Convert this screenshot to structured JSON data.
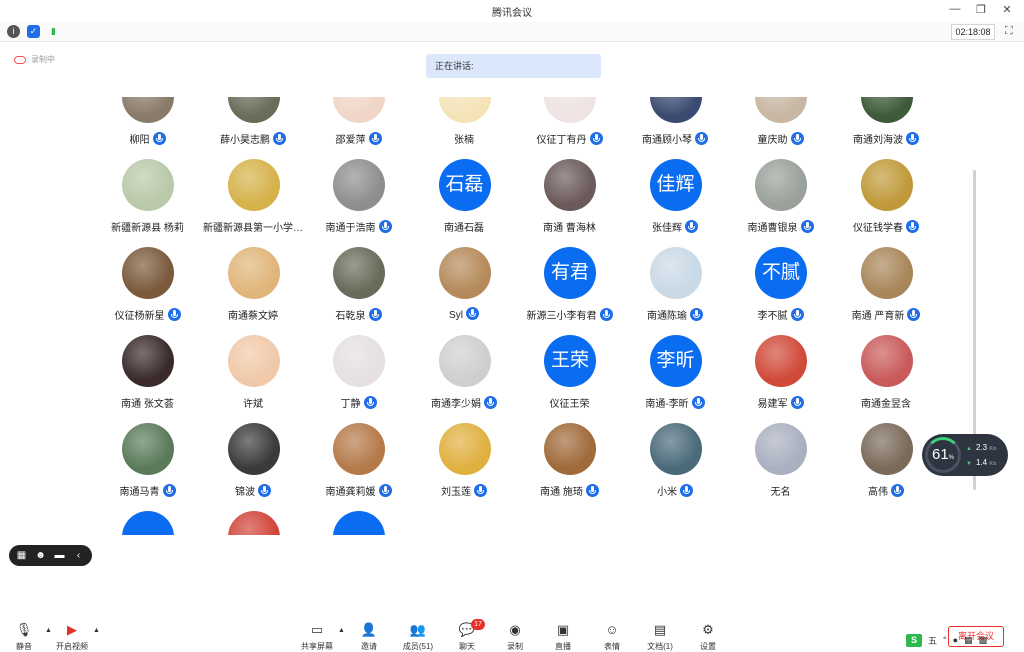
{
  "window": {
    "title": "腾讯会议",
    "controls": [
      "—",
      "❐",
      "✕"
    ]
  },
  "status": {
    "clock": "02:18:08",
    "icons": [
      "info-icon",
      "shield-icon",
      "signal-icon"
    ]
  },
  "recording": {
    "label": "录制中"
  },
  "speaking": {
    "label": "正在讲话:"
  },
  "participants": [
    {
      "name": "柳阳",
      "mic": true,
      "avatar": "photo",
      "color": "#8a7a6a"
    },
    {
      "name": "薛小昊志鹏",
      "mic": true,
      "avatar": "photo",
      "color": "#6b6b5a"
    },
    {
      "name": "邵爱萍",
      "mic": true,
      "avatar": "photo",
      "color": "#f1d6c8"
    },
    {
      "name": "张楠",
      "mic": false,
      "avatar": "photo",
      "color": "#f5e3b8"
    },
    {
      "name": "仪征丁有丹",
      "mic": true,
      "avatar": "photo",
      "color": "#efe3e3"
    },
    {
      "name": "南通顾小琴",
      "mic": true,
      "avatar": "photo",
      "color": "#3b4a70"
    },
    {
      "name": "童庆助",
      "mic": true,
      "avatar": "photo",
      "color": "#c7b7a3"
    },
    {
      "name": "南通刘海波",
      "mic": true,
      "avatar": "photo",
      "color": "#3e5a3a"
    },
    {
      "name": "新疆新源县 杨莉",
      "mic": false,
      "avatar": "photo",
      "color": "#b9c9a9"
    },
    {
      "name": "新疆新源县第一小学…",
      "mic": false,
      "avatar": "photo",
      "color": "#d5b24a"
    },
    {
      "name": "南通于浩南",
      "mic": true,
      "avatar": "photo",
      "color": "#8e8e8e"
    },
    {
      "name": "南通石磊",
      "mic": false,
      "avatar": "text",
      "text": "石磊"
    },
    {
      "name": "南通 曹海林",
      "mic": false,
      "avatar": "photo",
      "color": "#6b5a5a"
    },
    {
      "name": "张佳辉",
      "mic": true,
      "avatar": "text",
      "text": "佳辉"
    },
    {
      "name": "南通曹银泉",
      "mic": true,
      "avatar": "photo",
      "color": "#9aa09a"
    },
    {
      "name": "仪征钱学春",
      "mic": true,
      "avatar": "photo",
      "color": "#c09a3a"
    },
    {
      "name": "仪征杨新星",
      "mic": true,
      "avatar": "photo",
      "color": "#7a5a3a"
    },
    {
      "name": "南通蔡文婷",
      "mic": false,
      "avatar": "photo",
      "color": "#e0b57a"
    },
    {
      "name": "石乾泉",
      "mic": true,
      "avatar": "photo",
      "color": "#6a6a5a"
    },
    {
      "name": "Syl",
      "mic": true,
      "avatar": "photo",
      "color": "#b58a5a"
    },
    {
      "name": "新源三小李有君",
      "mic": true,
      "avatar": "text",
      "text": "有君"
    },
    {
      "name": "南通陈瑜",
      "mic": true,
      "avatar": "photo",
      "color": "#c9d9e6"
    },
    {
      "name": "李不腻",
      "mic": true,
      "avatar": "text",
      "text": "不腻"
    },
    {
      "name": "南通 严育新",
      "mic": true,
      "avatar": "photo",
      "color": "#a9865a"
    },
    {
      "name": "南通 张文荟",
      "mic": false,
      "avatar": "photo",
      "color": "#3a2a2a"
    },
    {
      "name": "许斌",
      "mic": false,
      "avatar": "photo",
      "color": "#f0c9a9"
    },
    {
      "name": "丁静",
      "mic": true,
      "avatar": "photo",
      "color": "#e6e0e0"
    },
    {
      "name": "南通李少娟",
      "mic": true,
      "avatar": "photo",
      "color": "#cfcfcf"
    },
    {
      "name": "仪征王荣",
      "mic": false,
      "avatar": "text",
      "text": "王荣"
    },
    {
      "name": "南通-李昕",
      "mic": true,
      "avatar": "text",
      "text": "李昕"
    },
    {
      "name": "易建军",
      "mic": true,
      "avatar": "photo",
      "color": "#d04a3a"
    },
    {
      "name": "南通金昱含",
      "mic": false,
      "avatar": "photo",
      "color": "#c95a5a"
    },
    {
      "name": "南通马青",
      "mic": true,
      "avatar": "photo",
      "color": "#5a7a5a"
    },
    {
      "name": "锦波",
      "mic": true,
      "avatar": "photo",
      "color": "#3a3a3a"
    },
    {
      "name": "南通龚莉媛",
      "mic": true,
      "avatar": "photo",
      "color": "#b57a4a"
    },
    {
      "name": "刘玉莲",
      "mic": true,
      "avatar": "photo",
      "color": "#e0b040"
    },
    {
      "name": "南通 施琦",
      "mic": true,
      "avatar": "photo",
      "color": "#a06a3a"
    },
    {
      "name": "小米",
      "mic": true,
      "avatar": "photo",
      "color": "#4a6a7a"
    },
    {
      "name": "无名",
      "mic": false,
      "avatar": "photo",
      "color": "#aab0c0"
    },
    {
      "name": "高伟",
      "mic": true,
      "avatar": "photo",
      "color": "#7a6a5a"
    },
    {
      "name": "",
      "mic": false,
      "avatar": "text",
      "text": ""
    },
    {
      "name": "",
      "mic": false,
      "avatar": "photo",
      "color": "#d0443a"
    },
    {
      "name": "",
      "mic": false,
      "avatar": "text",
      "text": ""
    }
  ],
  "network": {
    "percent": "61",
    "percent_unit": "%",
    "up": "2.3",
    "down": "1.4",
    "unit": "K/s"
  },
  "toolbar": {
    "mute": "静音",
    "video": "开启视频",
    "share": "共享屏幕",
    "invite": "邀请",
    "members": "成员(51)",
    "chat": "聊天",
    "chat_badge": "17",
    "record": "录制",
    "live": "直播",
    "reactions": "表情",
    "docs": "文档(1)",
    "settings": "设置",
    "leave": "离开会议"
  },
  "ime": {
    "label": "五"
  }
}
